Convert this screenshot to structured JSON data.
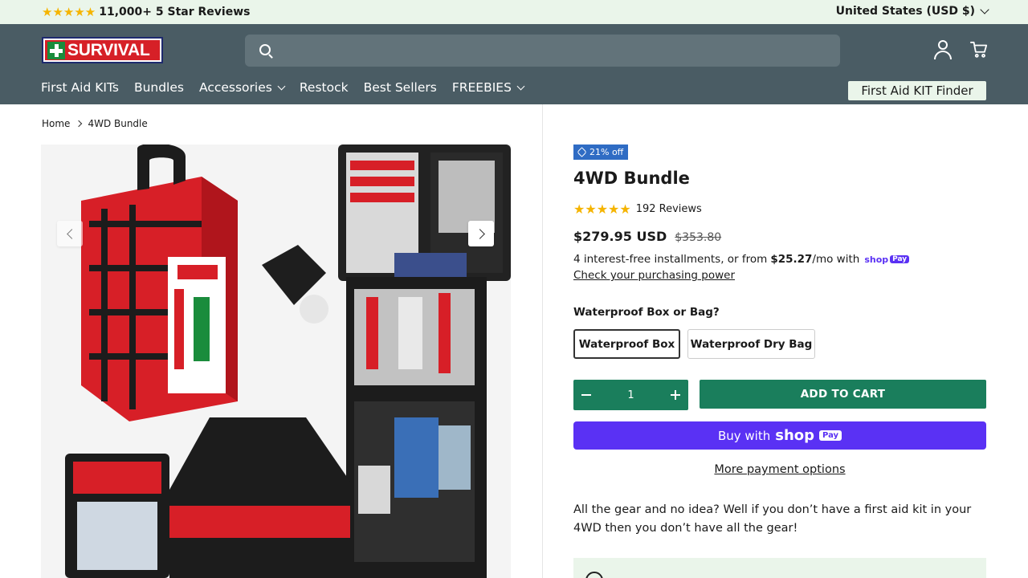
{
  "announcement": {
    "stars": "★★★★★",
    "reviews_text": "11,000+ 5 Star Reviews",
    "currency": "United States (USD $)"
  },
  "header": {
    "logo_text": "SURVIVAL",
    "nav": [
      "First Aid KITs",
      "Bundles",
      "Accessories",
      "Restock",
      "Best Sellers",
      "FREEBIES"
    ],
    "kit_finder": "First Aid KIT Finder"
  },
  "breadcrumb": {
    "home": "Home",
    "current": "4WD Bundle"
  },
  "product": {
    "badge": "21% off",
    "title": "4WD Bundle",
    "stars": "★★★★★",
    "reviews": "192 Reviews",
    "price": "$279.95 USD",
    "compare_price": "$353.80",
    "install_prefix": "4 interest-free installments, or from",
    "install_amount": "$25.27",
    "install_suffix": "/mo with",
    "shop_pay_label": "shop",
    "shop_pay_badge": "Pay",
    "check_power": "Check your purchasing power",
    "option_label": "Waterproof Box or Bag?",
    "options": [
      "Waterproof Box",
      "Waterproof Dry Bag"
    ],
    "quantity": "1",
    "add_to_cart": "ADD TO CART",
    "buy_with": "Buy with",
    "buy_shop": "shop",
    "buy_pay": "Pay",
    "more_payment": "More payment options",
    "description": "All the gear and no idea? Well if you don’t have a first aid kit in your 4WD then you don’t have all the gear!"
  },
  "colors": {
    "header_bg": "#4a5c64",
    "announce_bg": "#eaf5ea",
    "accent_green": "#1a7e5c",
    "shop_pay_purple": "#5a31f4",
    "badge_blue": "#2f6cc4",
    "star_yellow": "#f5b400"
  }
}
